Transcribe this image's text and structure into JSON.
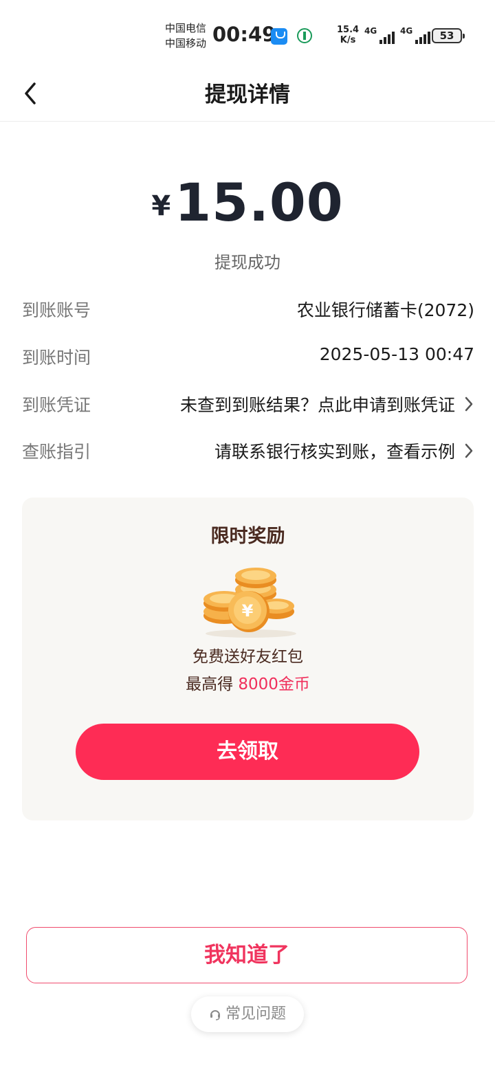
{
  "status_bar": {
    "carrier_1": "中国电信",
    "carrier_2": "中国移动",
    "time": "00:49",
    "net_speed_value": "15.4",
    "net_speed_unit": "K/s",
    "signal_1_type": "4G",
    "signal_2_type": "4G",
    "battery": "53"
  },
  "header": {
    "title": "提现详情"
  },
  "amount": {
    "currency": "¥",
    "value": "15.00",
    "status": "提现成功"
  },
  "details": [
    {
      "label": "到账账号",
      "value": "农业银行储蓄卡(2072)",
      "link": false
    },
    {
      "label": "到账时间",
      "value": "2025-05-13 00:47",
      "link": false
    },
    {
      "label": "到账凭证",
      "value": "未查到到账结果？点此申请到账凭证",
      "link": true
    },
    {
      "label": "查账指引",
      "value": "请联系银行核实到账，查看示例",
      "link": true
    }
  ],
  "reward": {
    "title": "限时奖励",
    "line1": "免费送好友红包",
    "line2_prefix": "最高得 ",
    "line2_highlight": "8000金币",
    "button": "去领取",
    "icon": "gold-coins-icon"
  },
  "footer": {
    "confirm_button": "我知道了",
    "faq_label": "常见问题"
  },
  "colors": {
    "accent": "#fe2c55",
    "reward_bg": "#f8f7f4",
    "text_brown": "#4a2a20"
  }
}
